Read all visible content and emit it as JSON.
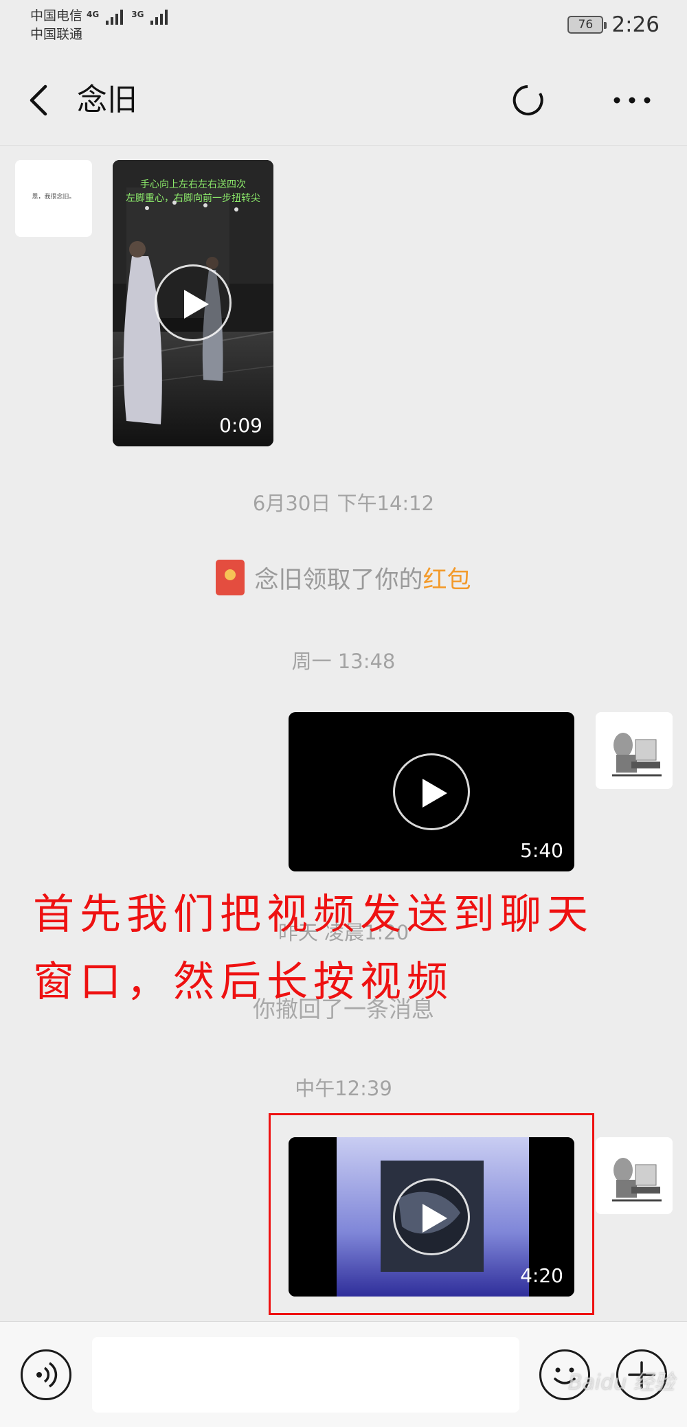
{
  "status_bar": {
    "carrier_1": "中国电信",
    "carrier_2": "中国联通",
    "network_1": "4G",
    "network_2": "3G",
    "battery": "76",
    "time": "2:26"
  },
  "header": {
    "title": "念旧",
    "back_icon": "chevron-left-icon",
    "refresh_icon": "circle-icon",
    "more_icon": "more-dots-icon"
  },
  "messages": {
    "video_1": {
      "caption_line_1": "手心向上左右左右送四次",
      "caption_line_2": "左脚重心，右脚向前一步扭转尖",
      "duration": "0:09",
      "avatar_text": "恩，我很念旧。"
    },
    "timestamp_1": "6月30日 下午14:12",
    "red_packet": {
      "text": "念旧领取了你的",
      "link": "红包"
    },
    "timestamp_2": "周一 13:48",
    "video_2": {
      "duration": "5:40"
    },
    "timestamp_3": "昨天 凌晨1:20",
    "recall": "你撤回了一条消息",
    "timestamp_4": "中午12:39",
    "video_3": {
      "duration": "4:20"
    }
  },
  "overlay": {
    "line_1": "首先我们把视频发送到聊天",
    "line_2": "窗口，然后长按视频"
  },
  "input_bar": {
    "voice_icon": "voice-icon",
    "emoji_icon": "emoji-icon",
    "plus_icon": "plus-icon"
  },
  "watermark": "Baidu 经验",
  "colors": {
    "background": "#ededed",
    "annotation_red": "#ee1111",
    "red_packet_link": "#f39a2a"
  }
}
